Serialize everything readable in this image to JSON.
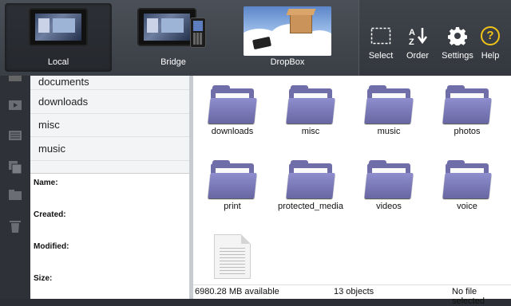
{
  "sources": [
    {
      "label": "Local",
      "active": true,
      "icon": "playbook-tablet-icon"
    },
    {
      "label": "Bridge",
      "active": false,
      "icon": "bridge-devices-icon"
    },
    {
      "label": "DropBox",
      "active": false,
      "icon": "dropbox-icon"
    }
  ],
  "toolbar": {
    "select_label": "Select",
    "order_label": "Order",
    "settings_label": "Settings",
    "help_label": "Help",
    "help_glyph": "?"
  },
  "sidebar_list": [
    "documents",
    "downloads",
    "misc",
    "music"
  ],
  "info_panel": {
    "name_label": "Name:",
    "created_label": "Created:",
    "modified_label": "Modified:",
    "size_label": "Size:"
  },
  "grid_items": [
    {
      "name": "downloads",
      "type": "folder"
    },
    {
      "name": "misc",
      "type": "folder"
    },
    {
      "name": "music",
      "type": "folder"
    },
    {
      "name": "photos",
      "type": "folder"
    },
    {
      "name": "print",
      "type": "folder"
    },
    {
      "name": "protected_media",
      "type": "folder"
    },
    {
      "name": "videos",
      "type": "folder"
    },
    {
      "name": "voice",
      "type": "folder"
    }
  ],
  "status": {
    "available": "6980.28 MB available",
    "count": "13 objects",
    "selection": "No file selected"
  },
  "colors": {
    "accent_help": "#f0c419",
    "folder": "#6f6ea8"
  }
}
